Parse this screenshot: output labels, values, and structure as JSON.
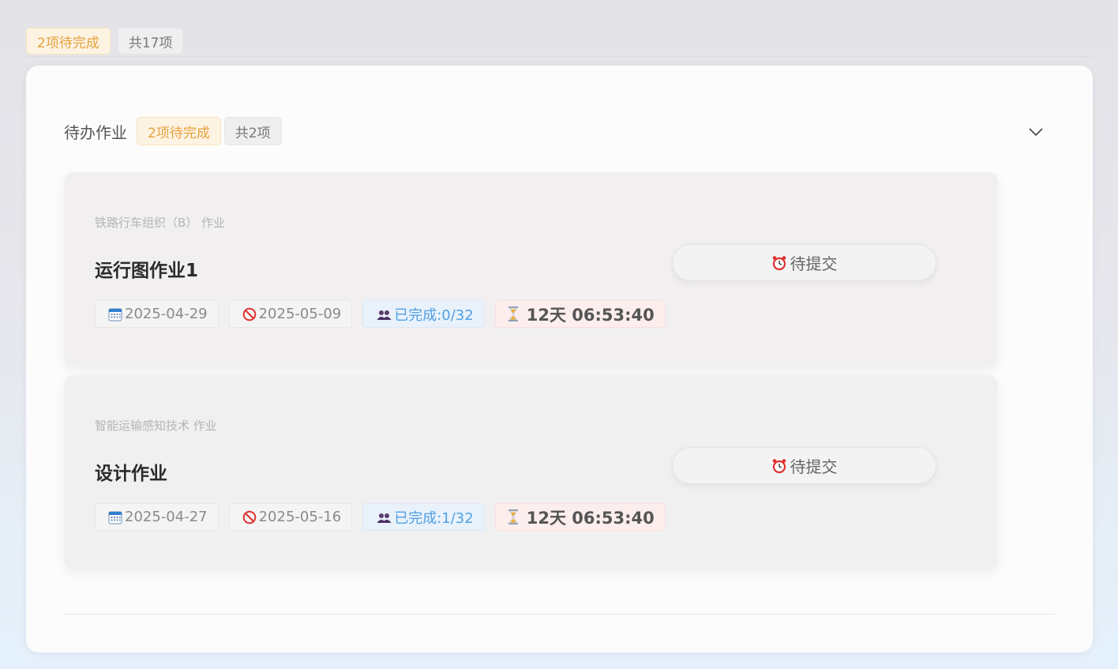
{
  "top_badges": {
    "pending": "2项待完成",
    "total": "共17项"
  },
  "section": {
    "title": "待办作业",
    "pending_badge": "2项待完成",
    "total_badge": "共2项"
  },
  "assignments": [
    {
      "course": "铁路行车组织（B） 作业",
      "title": "运行图作业1",
      "start_date": "2025-04-29",
      "deadline": "2025-05-09",
      "completion": "已完成:0/32",
      "countdown": "12天 06:53:40",
      "status_label": "待提交"
    },
    {
      "course": "智能运输感知技术 作业",
      "title": "设计作业",
      "start_date": "2025-04-27",
      "deadline": "2025-05-16",
      "completion": "已完成:1/32",
      "countdown": "12天 06:53:40",
      "status_label": "待提交"
    }
  ],
  "icons": {
    "start_date": "calendar-icon",
    "deadline": "prohibited-icon",
    "completion": "people-icon",
    "countdown": "hourglass-icon",
    "status": "alarm-clock-icon",
    "collapse": "chevron-down-icon"
  },
  "colors": {
    "pending": "#e6a23c",
    "progress": "#4f9fe3",
    "deadline_icon": "#e03131"
  }
}
